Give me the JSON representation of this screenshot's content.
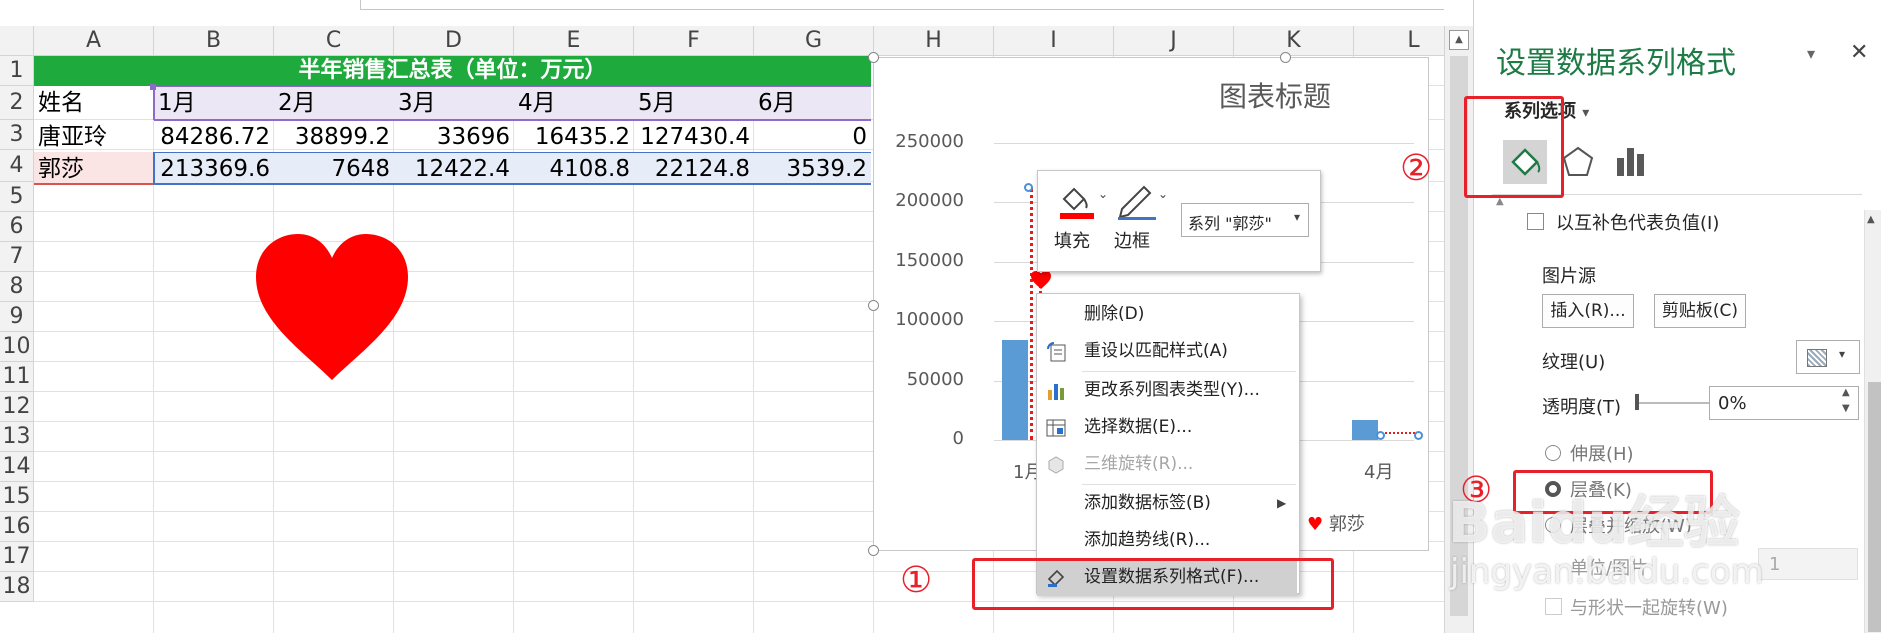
{
  "sheet": {
    "columns": [
      "A",
      "B",
      "C",
      "D",
      "E",
      "F",
      "G",
      "H",
      "I",
      "J",
      "K",
      "L"
    ],
    "rows": [
      "1",
      "2",
      "3",
      "4",
      "5",
      "6",
      "7",
      "8",
      "9",
      "10",
      "11",
      "12",
      "13",
      "14",
      "15",
      "16",
      "17",
      "18"
    ],
    "title": "半年销售汇总表（单位：万元）",
    "header": [
      "姓名",
      "1月",
      "2月",
      "3月",
      "4月",
      "5月",
      "6月"
    ],
    "data": [
      [
        "唐亚玲",
        "84286.72",
        "38899.2",
        "33696",
        "16435.2",
        "127430.4",
        "0"
      ],
      [
        "郭莎",
        "213369.6",
        "7648",
        "12422.4",
        "4108.8",
        "22124.8",
        "3539.2"
      ]
    ]
  },
  "chart": {
    "title": "图表标题",
    "yticks": [
      "250000",
      "200000",
      "150000",
      "100000",
      "50000",
      "0"
    ],
    "xticks": [
      "1月",
      "4月"
    ],
    "legend_series": "郭莎",
    "chart_data": {
      "type": "bar",
      "categories": [
        "1月",
        "2月",
        "3月",
        "4月",
        "5月",
        "6月"
      ],
      "series": [
        {
          "name": "唐亚玲",
          "values": [
            84286.72,
            38899.2,
            33696,
            16435.2,
            127430.4,
            0
          ]
        },
        {
          "name": "郭莎",
          "values": [
            213369.6,
            7648,
            12422.4,
            4108.8,
            22124.8,
            3539.2
          ]
        }
      ],
      "ylim": [
        0,
        250000
      ]
    }
  },
  "minitoolbar": {
    "fill_label": "填充",
    "border_label": "边框",
    "series_select": "系列 \"郭莎\""
  },
  "context_menu": {
    "items": [
      {
        "label": "删除(D)"
      },
      {
        "label": "重设以匹配样式(A)"
      },
      {
        "label": "更改系列图表类型(Y)..."
      },
      {
        "label": "选择数据(E)..."
      },
      {
        "label": "三维旋转(R)..."
      },
      {
        "label": "添加数据标签(B)"
      },
      {
        "label": "添加趋势线(R)..."
      },
      {
        "label": "设置数据系列格式(F)..."
      }
    ]
  },
  "pane": {
    "title": "设置数据系列格式",
    "series_options": "系列选项",
    "invert_if_negative": "以互补色代表负值(I)",
    "picture_source": "图片源",
    "insert_btn": "插入(R)...",
    "clipboard_btn": "剪贴板(C)",
    "texture": "纹理(U)",
    "transparency": "透明度(T)",
    "transparency_value": "0%",
    "stretch": "伸展(H)",
    "stack": "层叠(K)",
    "stack_scale": "层叠并缩放(W)",
    "units_picture": "单位/图片",
    "units_value": "1",
    "rotate_with_shape": "与形状一起旋转(W)"
  },
  "annotations": {
    "mark1": "①",
    "mark2": "②",
    "mark3": "③"
  },
  "watermark": {
    "text": "Baidu经验",
    "url": "jingyan.baidu.com"
  },
  "colors": {
    "title_bg": "#1faa3e",
    "bar_blue": "#5b9bd5",
    "heart_red": "#ff0000",
    "annotation_red": "#e8202a",
    "pane_title": "#1e7b46"
  }
}
